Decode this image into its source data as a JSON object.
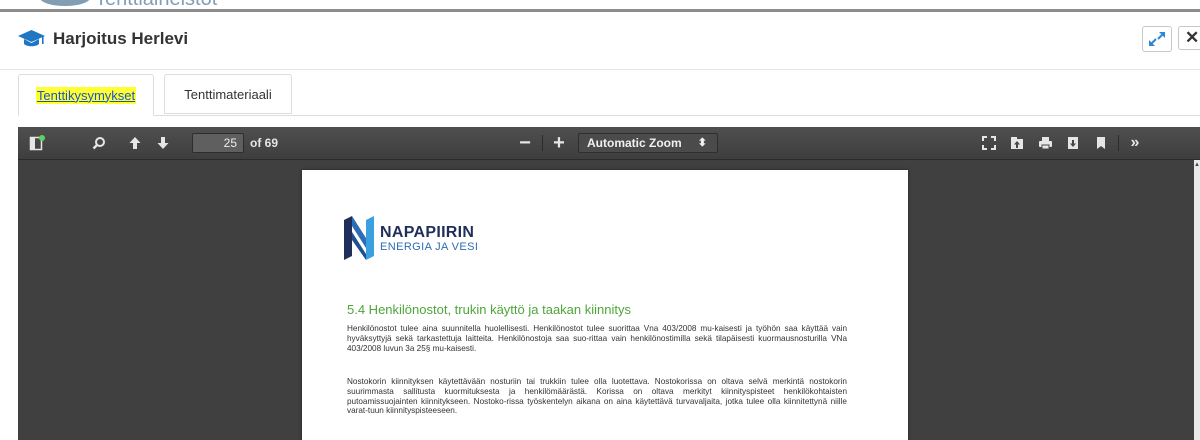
{
  "background": {
    "partial_title": "Tenttiaineistot"
  },
  "modal": {
    "title": "Harjoitus Herlevi",
    "close_label": "✕"
  },
  "tabs": [
    {
      "label": "Tenttikysymykset",
      "active": true
    },
    {
      "label": "Tenttimateriaali",
      "active": false
    }
  ],
  "pdf_toolbar": {
    "page_number": "25",
    "page_count_label": "of 69",
    "zoom": "Automatic Zoom",
    "zoom_out_label": "−",
    "zoom_in_label": "+"
  },
  "document": {
    "logo_main": "NAPAPIIRIN",
    "logo_sub": "ENERGIA JA VESI",
    "section_title": "5.4   Henkilönostot, trukin käyttö ja taakan kiinnitys",
    "paragraph_1": "Henkilönostot tulee aina suunnitella huolellisesti. Henkilönostot tulee suorittaa Vna 403/2008 mu-kaisesti ja työhön saa käyttää vain hyväksyttyjä sekä tarkastettuja laitteita. Henkilönostoja saa suo-rittaa vain henkilönostimilla sekä tilapäisesti kuormausnosturilla VNa 403/2008 luvun 3a 25§ mu-kaisesti.",
    "paragraph_2": "Nostokorin kiinnityksen käytettävään nosturiin tai trukkiin tulee olla luotettava. Nostokorissa on oltava selvä merkintä nostokorin suurimmasta sallitusta kuormituksesta ja henkilömäärästä. Korissa on oltava merkityt kiinnityspisteet henkilökohtaisten putoamissuojainten kiinnitykseen.  Nostoko-rissa työskentelyn aikana on aina käytettävä turvavaljaita, jotka tulee olla kiinnitettynä niille varat-tuun kiinnityspisteeseen."
  },
  "colors": {
    "tab_highlight": "#ffff32",
    "section_title": "#4fa53a",
    "toolbar": "#474747",
    "viewer_bg": "#404040"
  }
}
